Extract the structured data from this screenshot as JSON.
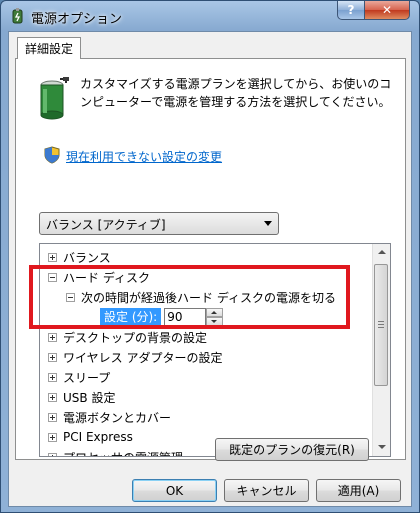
{
  "window": {
    "title": "電源オプション",
    "help_label": "?",
    "close_label": "✕"
  },
  "tab": {
    "label": "詳細設定"
  },
  "description": "カスタマイズする電源プランを選択してから、お使いのコンピューターで電源を管理する方法を選択してください。",
  "link": {
    "label": "現在利用できない設定の変更"
  },
  "plan_select": {
    "value": "バランス [アクティブ]"
  },
  "tree": {
    "balance": "バランス",
    "hard_disk": "ハード ディスク",
    "turn_off_after": "次の時間が経過後ハード ディスクの電源を切る",
    "setting_label": "設定 (分):",
    "setting_value": "90",
    "desktop_bg": "デスクトップの背景の設定",
    "wireless": "ワイヤレス アダプターの設定",
    "sleep": "スリープ",
    "usb": "USB 設定",
    "power_buttons": "電源ボタンとカバー",
    "pci": "PCI Express",
    "processor": "プロセッサの電源管理"
  },
  "buttons": {
    "restore": "既定のプランの復元(R)",
    "ok": "OK",
    "cancel": "キャンセル",
    "apply": "適用(A)"
  },
  "colors": {
    "highlight_border": "#e0181e",
    "selection": "#3399ff",
    "link": "#0066cc"
  }
}
